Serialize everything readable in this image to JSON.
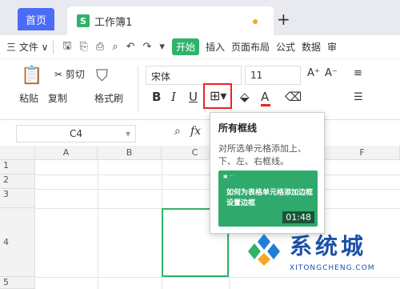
{
  "tabs": {
    "home": "首页",
    "doc_icon": "S",
    "doc": "工作簿1",
    "add": "+"
  },
  "menubar": {
    "file": "三 文件 ∨",
    "start": "开始",
    "items": [
      "插入",
      "页面布局",
      "公式",
      "数据",
      "审"
    ]
  },
  "ribbon": {
    "paste": "粘贴",
    "cut": "✂ 剪切",
    "copy": "复制",
    "format_painter": "格式刷",
    "font": "宋体",
    "size": "11",
    "bold": "B",
    "italic": "I",
    "underline": "U"
  },
  "formula": {
    "cell": "C4",
    "fx": "fx"
  },
  "columns": [
    "A",
    "B",
    "C",
    "F"
  ],
  "rows": [
    "1",
    "2",
    "3",
    "4",
    "5"
  ],
  "popup": {
    "title": "所有框线",
    "desc": "对所选单元格添加上、下、左、右框线。",
    "video_text": "如何为表格单元格添加边框设置边框",
    "video_time": "01:48"
  },
  "watermark": {
    "title": "系统城",
    "sub": "XITONGCHENG.COM"
  },
  "colors": {
    "accent": "#4a6cf7",
    "green": "#2fb36a",
    "highlight": "#e22222"
  }
}
